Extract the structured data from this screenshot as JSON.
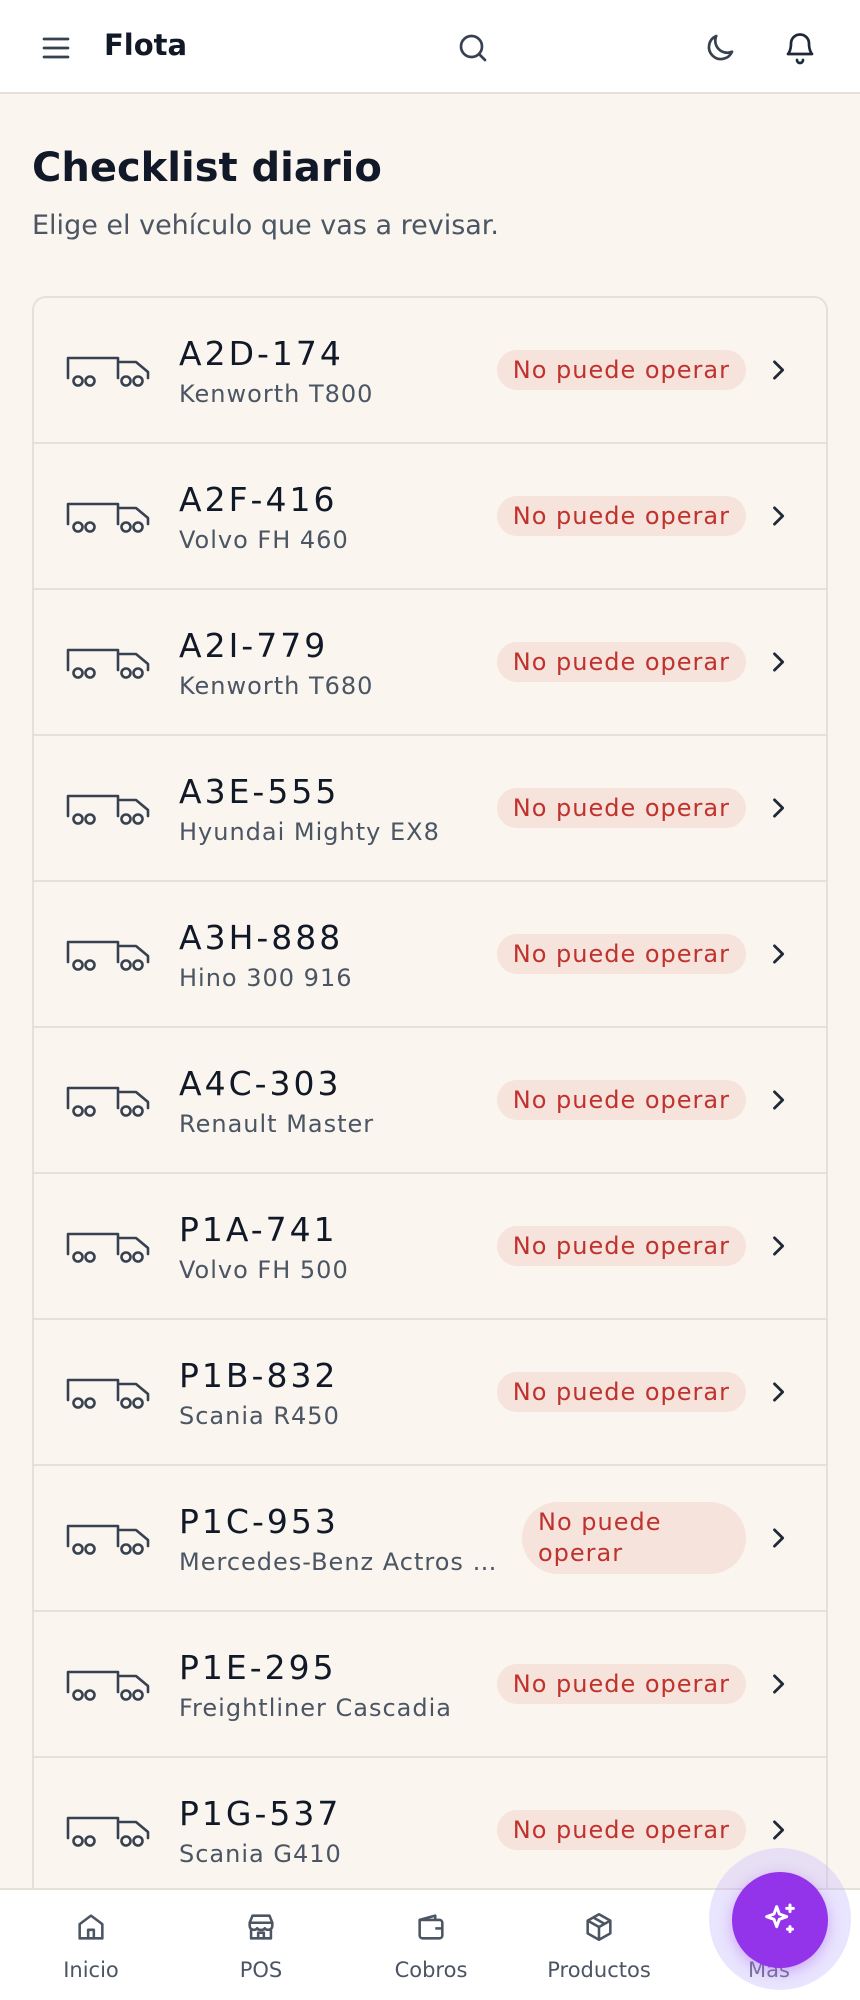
{
  "app": {
    "title": "Flota"
  },
  "icons": {
    "menu": "menu-icon",
    "search": "search-icon",
    "theme": "moon-icon",
    "notifications": "bell-icon",
    "vehicle": "truck-icon",
    "chevron": "chevron-right-icon",
    "fab": "sparkles-icon"
  },
  "colors": {
    "background": "#faf6ef",
    "badge_bg": "#f5e3dc",
    "badge_text": "#c0322d",
    "fab": "#9333ea"
  },
  "page": {
    "title": "Checklist diario",
    "subtitle": "Elige el vehículo que vas a revisar."
  },
  "vehicles": [
    {
      "plate": "A2D-174",
      "model": "Kenworth T800",
      "status": "No puede operar"
    },
    {
      "plate": "A2F-416",
      "model": "Volvo FH 460",
      "status": "No puede operar"
    },
    {
      "plate": "A2I-779",
      "model": "Kenworth T680",
      "status": "No puede operar"
    },
    {
      "plate": "A3E-555",
      "model": "Hyundai Mighty EX8",
      "status": "No puede operar"
    },
    {
      "plate": "A3H-888",
      "model": "Hino 300 916",
      "status": "No puede operar"
    },
    {
      "plate": "A4C-303",
      "model": "Renault Master",
      "status": "No puede operar"
    },
    {
      "plate": "P1A-741",
      "model": "Volvo FH 500",
      "status": "No puede operar"
    },
    {
      "plate": "P1B-832",
      "model": "Scania R450",
      "status": "No puede operar"
    },
    {
      "plate": "P1C-953",
      "model": "Mercedes-Benz Actros 2...",
      "status": "No puede operar"
    },
    {
      "plate": "P1E-295",
      "model": "Freightliner Cascadia",
      "status": "No puede operar"
    },
    {
      "plate": "P1G-537",
      "model": "Scania G410",
      "status": "No puede operar"
    },
    {
      "plate": "",
      "model": "",
      "status": ""
    }
  ],
  "bottom_nav": [
    {
      "label": "Inicio",
      "icon": "home-icon"
    },
    {
      "label": "POS",
      "icon": "store-icon"
    },
    {
      "label": "Cobros",
      "icon": "wallet-icon"
    },
    {
      "label": "Productos",
      "icon": "package-icon"
    },
    {
      "label": "Más",
      "icon": "more-icon"
    }
  ]
}
